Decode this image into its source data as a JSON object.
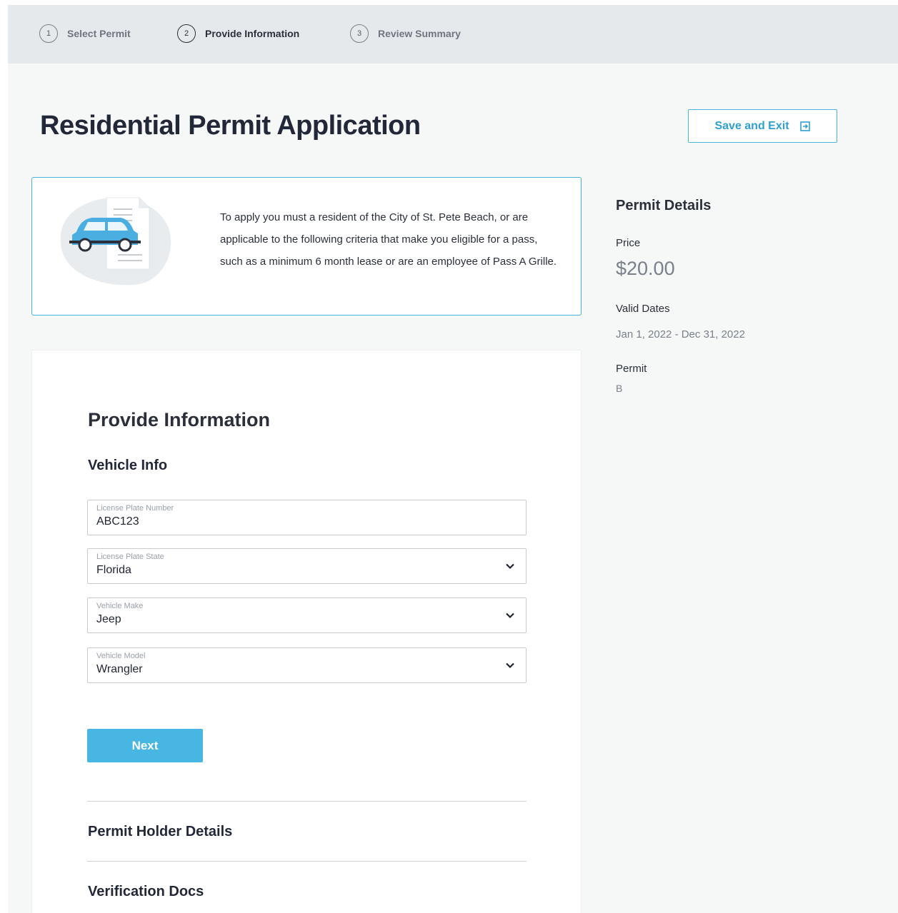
{
  "stepper": {
    "steps": [
      {
        "number": "1",
        "label": "Select Permit"
      },
      {
        "number": "2",
        "label": "Provide Information"
      },
      {
        "number": "3",
        "label": "Review Summary"
      }
    ],
    "active_index": 1
  },
  "header": {
    "title": "Residential Permit Application",
    "save_exit_label": "Save and Exit"
  },
  "info": {
    "text": "To apply you must a resident of the City of St. Pete Beach, or are applicable to the following criteria that make you eligible for a pass, such as a minimum 6 month lease or are an employee of Pass A Grille."
  },
  "form": {
    "section_title": "Provide Information",
    "subsection_title": "Vehicle Info",
    "fields": [
      {
        "label": "License Plate Number",
        "value": "ABC123",
        "type": "text"
      },
      {
        "label": "License Plate State",
        "value": "Florida",
        "type": "select"
      },
      {
        "label": "Vehicle Make",
        "value": "Jeep",
        "type": "select"
      },
      {
        "label": "Vehicle Model",
        "value": "Wrangler",
        "type": "select"
      }
    ],
    "next_label": "Next",
    "collapsed_sections": [
      "Permit Holder Details",
      "Verification Docs"
    ]
  },
  "details": {
    "title": "Permit Details",
    "price_label": "Price",
    "price_value": "$20.00",
    "dates_label": "Valid Dates",
    "dates_value": "Jan 1, 2022 - Dec 31, 2022",
    "permit_label": "Permit",
    "permit_value": "B"
  },
  "colors": {
    "accent": "#48b6e3",
    "accent_text": "#2f9fd0",
    "stepper_bg": "#e6e9eb",
    "page_bg": "#f6f8f8"
  },
  "icons": {
    "save_exit": "exit-icon",
    "select": "chevron-down-icon",
    "illustration": "car-document-icon"
  }
}
